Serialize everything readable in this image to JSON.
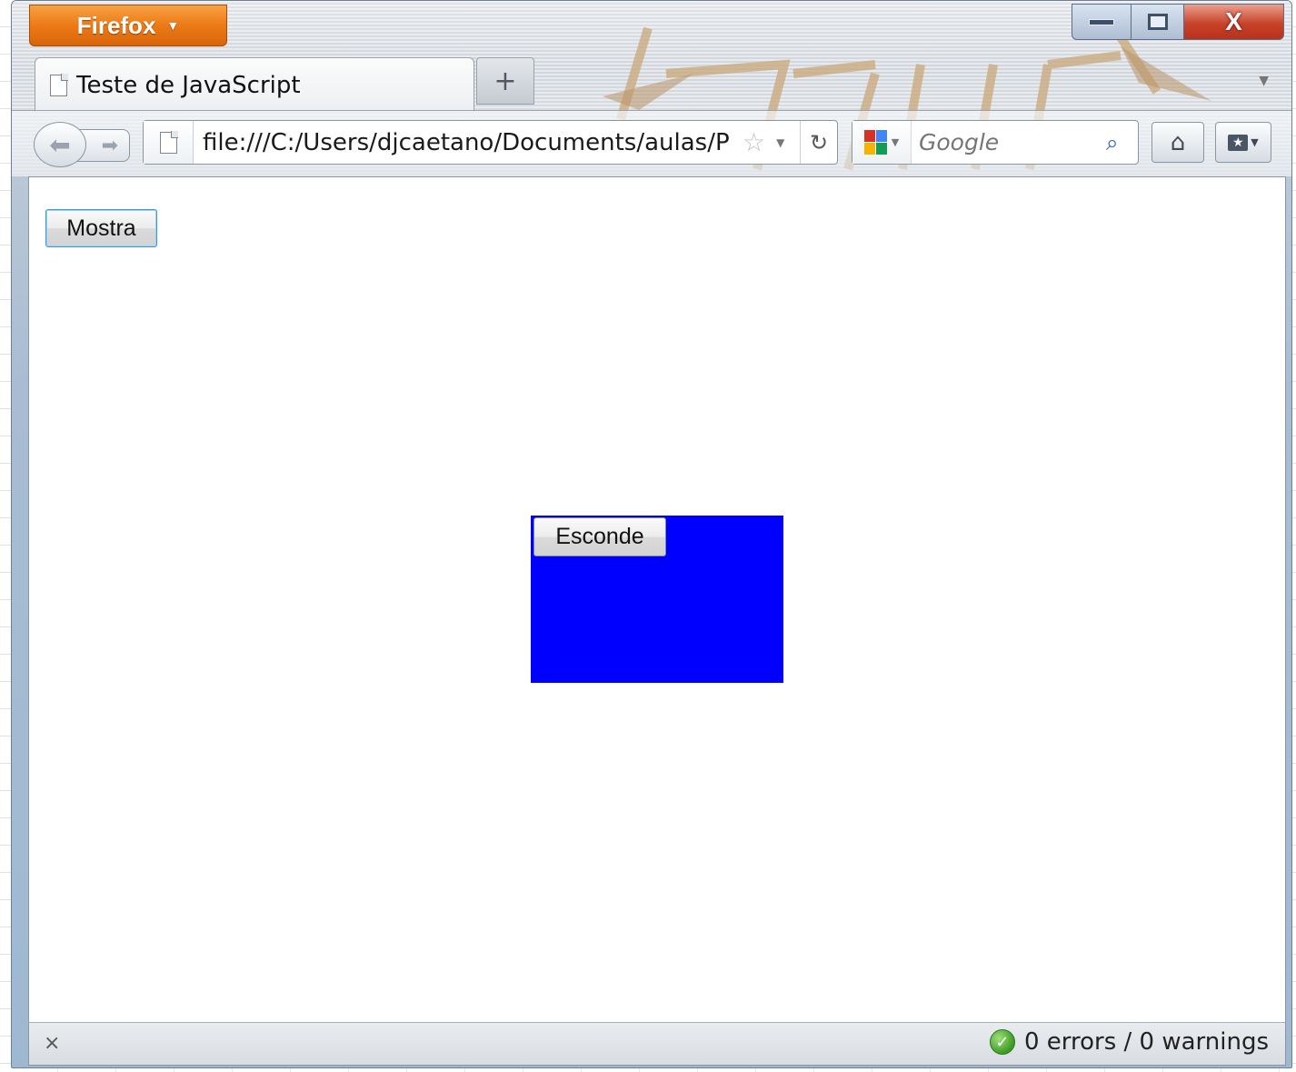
{
  "browser": {
    "menu_button": "Firefox",
    "tab_title": "Teste de JavaScript",
    "new_tab": "+",
    "url": "file:///C:/Users/djcaetano/Documents/aulas/P",
    "search_placeholder": "Google",
    "status_close": "×",
    "status_message": "0 errors / 0 warnings"
  },
  "page": {
    "mostra_button": "Mostra",
    "esconde_button": "Esconde",
    "box_color": "#0000ff"
  },
  "window_controls": {
    "close_label": "X"
  },
  "colors": {
    "firefox_orange": "#ec7a16",
    "close_red": "#c8432a",
    "status_ok_green": "#3c9a25"
  }
}
